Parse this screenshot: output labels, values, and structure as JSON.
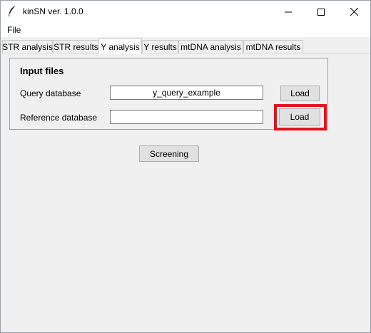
{
  "window": {
    "title": "kinSN ver. 1.0.0",
    "icon": "feather-icon"
  },
  "menu": {
    "file": "File"
  },
  "tabs": [
    {
      "label": "STR analysis"
    },
    {
      "label": "STR results"
    },
    {
      "label": "Y analysis",
      "active": true
    },
    {
      "label": "Y results"
    },
    {
      "label": "mtDNA analysis"
    },
    {
      "label": "mtDNA results"
    }
  ],
  "input_files": {
    "title": "Input files",
    "query": {
      "label": "Query database",
      "value": "y_query_example",
      "button": "Load"
    },
    "reference": {
      "label": "Reference database",
      "value": "",
      "button": "Load"
    }
  },
  "actions": {
    "screening": "Screening"
  },
  "colors": {
    "highlight": "#e0141e",
    "focus": "#0078d7"
  }
}
